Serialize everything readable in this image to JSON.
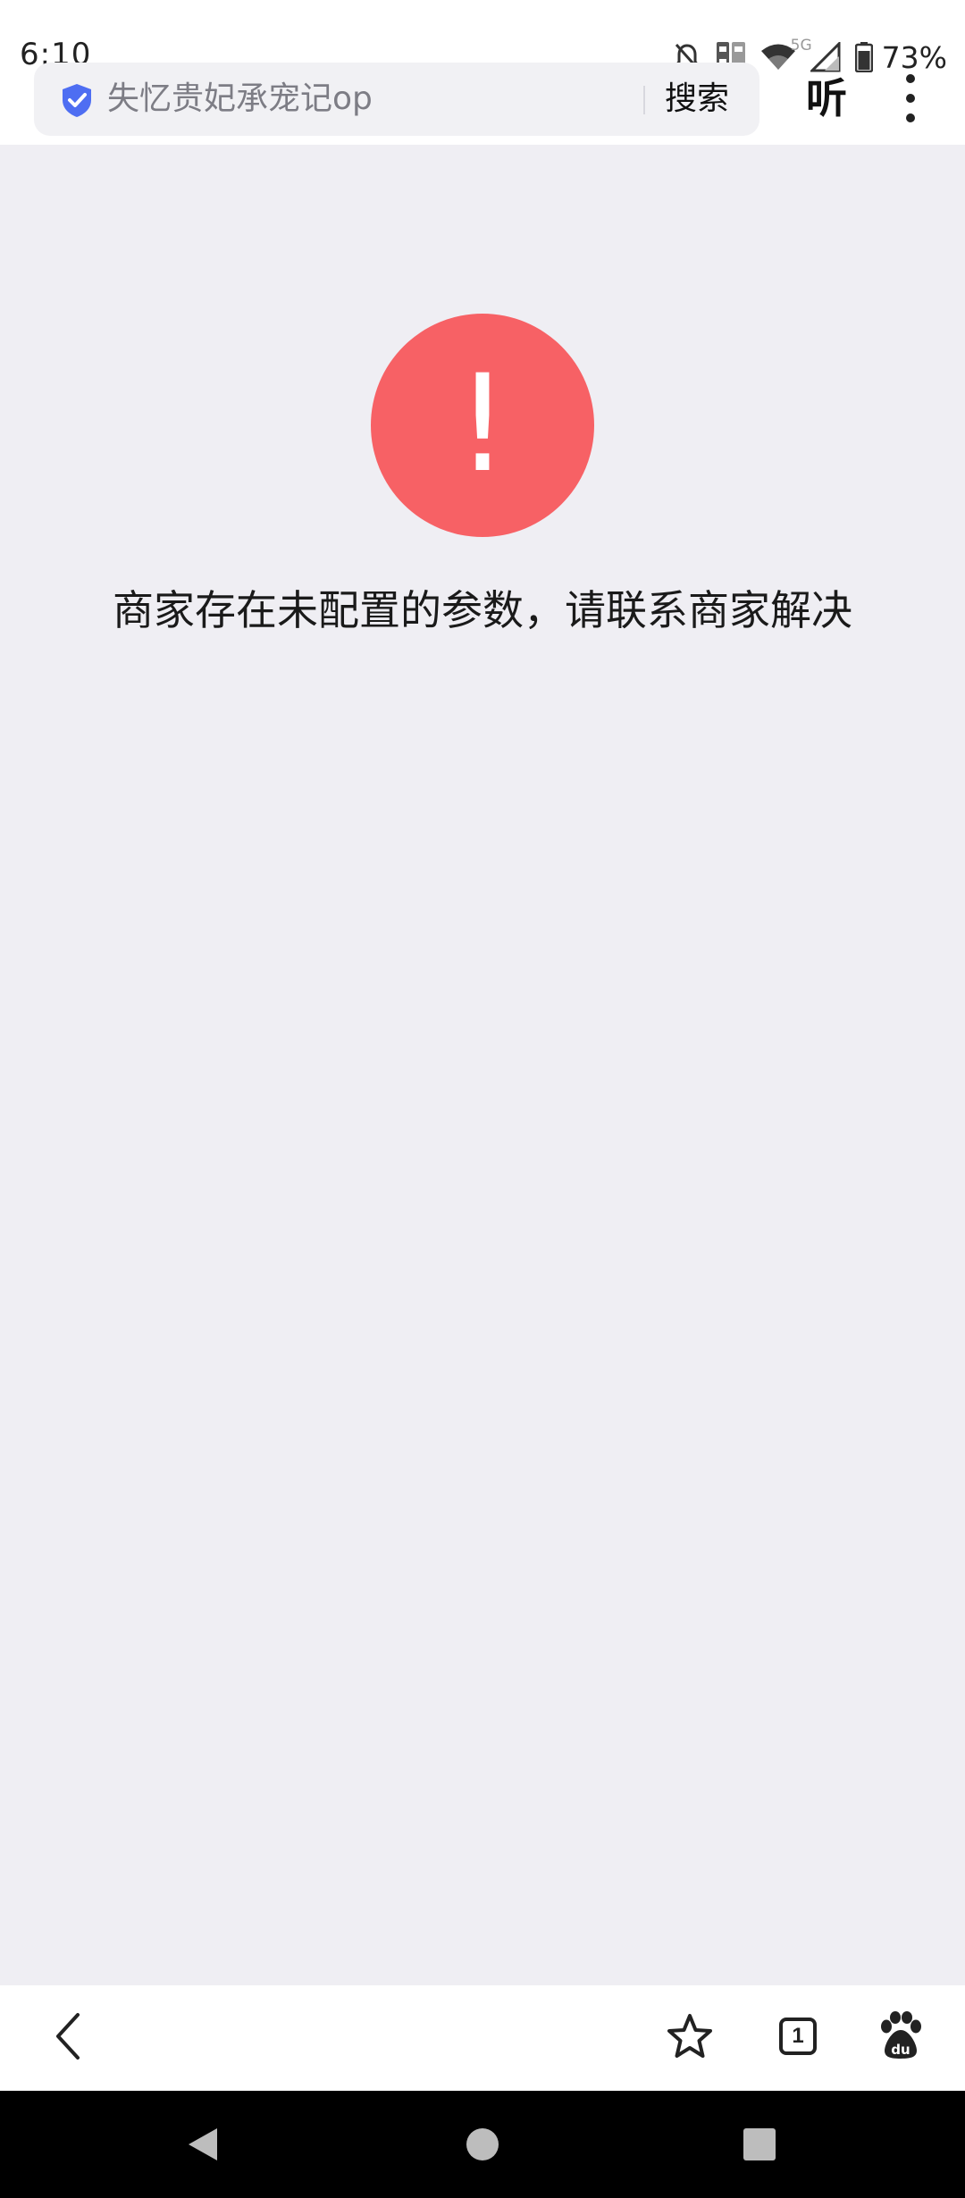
{
  "status_bar": {
    "time": "6:10",
    "network_label": "5G",
    "battery_percent": "73%",
    "icons": [
      "bell-off-icon",
      "sim-icon",
      "wifi-icon",
      "signal-icon",
      "battery-icon"
    ]
  },
  "browser": {
    "address_text": "失忆贵妃承宠记op",
    "search_label": "搜索",
    "listen_label": "听",
    "tab_count": "1"
  },
  "error": {
    "message": "商家存在未配置的参数，请联系商家解决",
    "icon_glyph": "!",
    "color": "#f76165"
  },
  "colors": {
    "page_background": "#efeef3",
    "shield": "#4e6ef2"
  }
}
